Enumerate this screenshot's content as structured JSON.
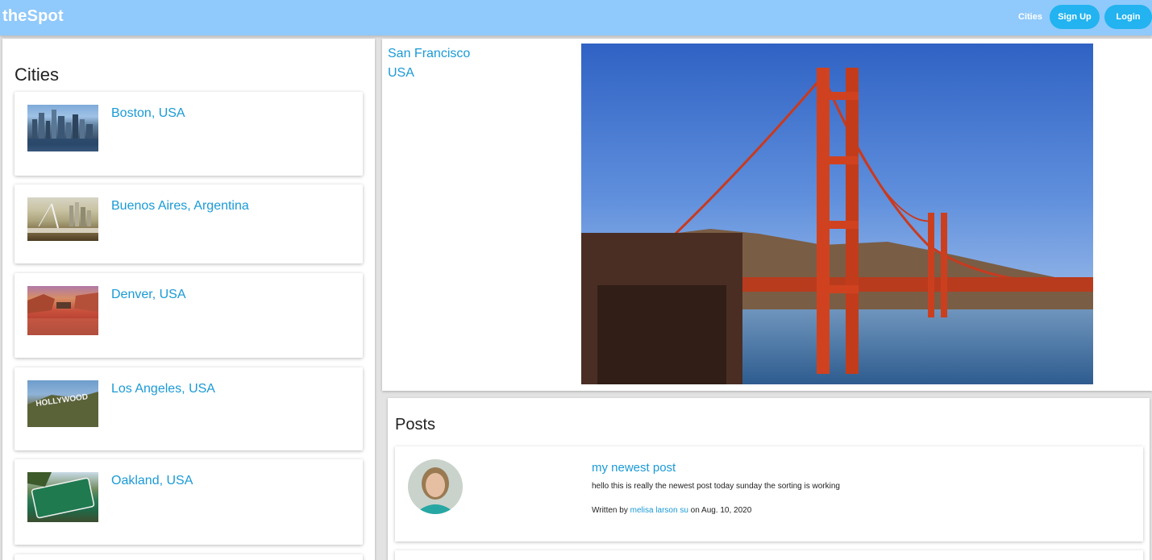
{
  "navbar": {
    "brand": "theSpot",
    "cities_link": "Cities",
    "signup_label": "Sign Up",
    "login_label": "Login"
  },
  "sidebar": {
    "title": "Cities",
    "cities": [
      {
        "label": "Boston, USA",
        "image": "boston-skyline-photo"
      },
      {
        "label": "Buenos Aires, Argentina",
        "image": "buenos-aires-bridge-photo"
      },
      {
        "label": "Denver, USA",
        "image": "red-rocks-amphitheatre-photo"
      },
      {
        "label": "Los Angeles, USA",
        "image": "hollywood-sign-photo"
      },
      {
        "label": "Oakland, USA",
        "image": "welcome-to-oakland-sign-photo"
      }
    ]
  },
  "hero": {
    "city": "San Francisco",
    "country": "USA",
    "image": "golden-gate-bridge-photo"
  },
  "posts": {
    "title": "Posts",
    "items": [
      {
        "title": "my newest post",
        "body": "hello this is really the newest post today sunday the sorting is working",
        "written_by": "Written by",
        "author": "melisa larson su",
        "on_date": "on Aug. 10, 2020",
        "avatar": "author-avatar-photo"
      }
    ]
  },
  "colors": {
    "navbar": "#90c9fb",
    "accent_button": "#22b3f0",
    "link": "#1a9ad6",
    "background": "#e3e3e3"
  }
}
